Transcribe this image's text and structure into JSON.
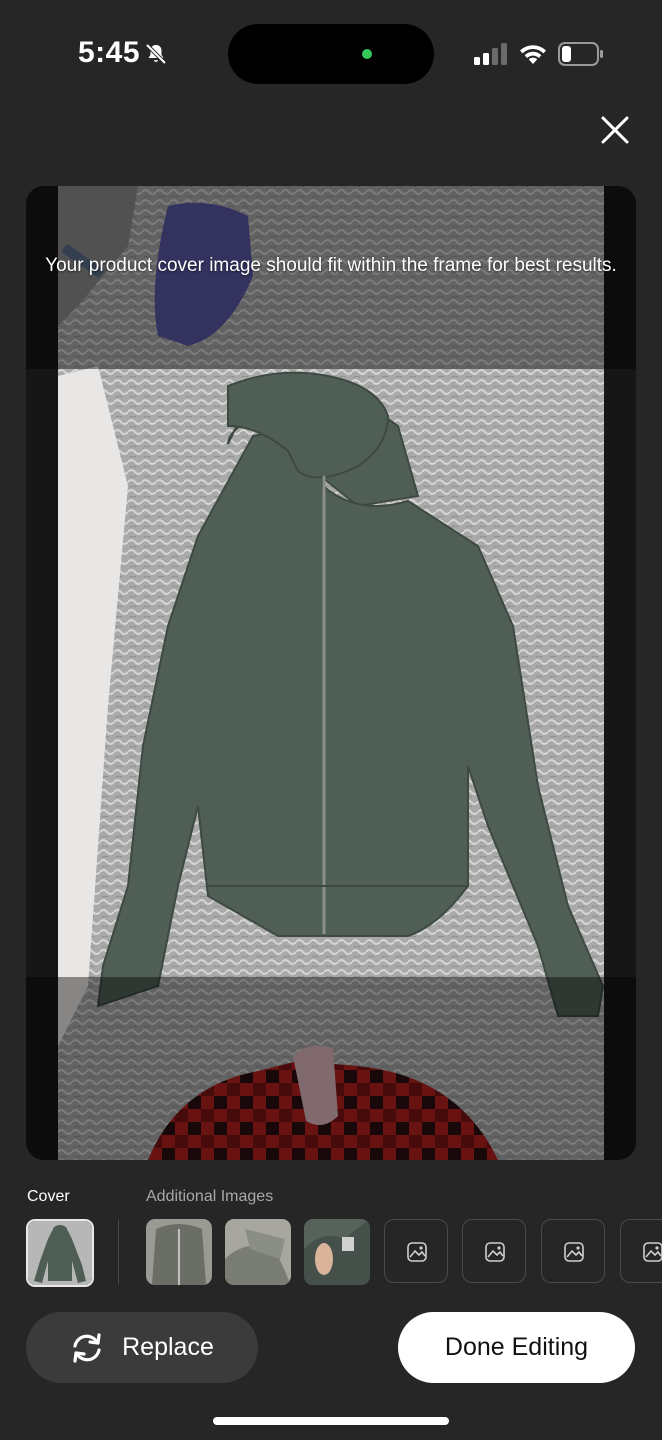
{
  "status_bar": {
    "time": "5:45"
  },
  "editor": {
    "hint": "Your product cover image should fit within the frame for best results."
  },
  "gallery": {
    "cover_label": "Cover",
    "additional_label": "Additional Images"
  },
  "actions": {
    "replace_label": "Replace",
    "done_label": "Done Editing"
  },
  "icons": {
    "mute": "bell-slash-icon",
    "signal": "cellular-signal-icon",
    "wifi": "wifi-icon",
    "battery": "battery-icon",
    "close": "close-icon",
    "replace": "refresh-icon",
    "placeholder": "image-placeholder-icon"
  },
  "colors": {
    "background": "#262626",
    "primary_button": "#ffffff",
    "secondary_button": "#3b3b3b",
    "camera_dot": "#35c759"
  }
}
